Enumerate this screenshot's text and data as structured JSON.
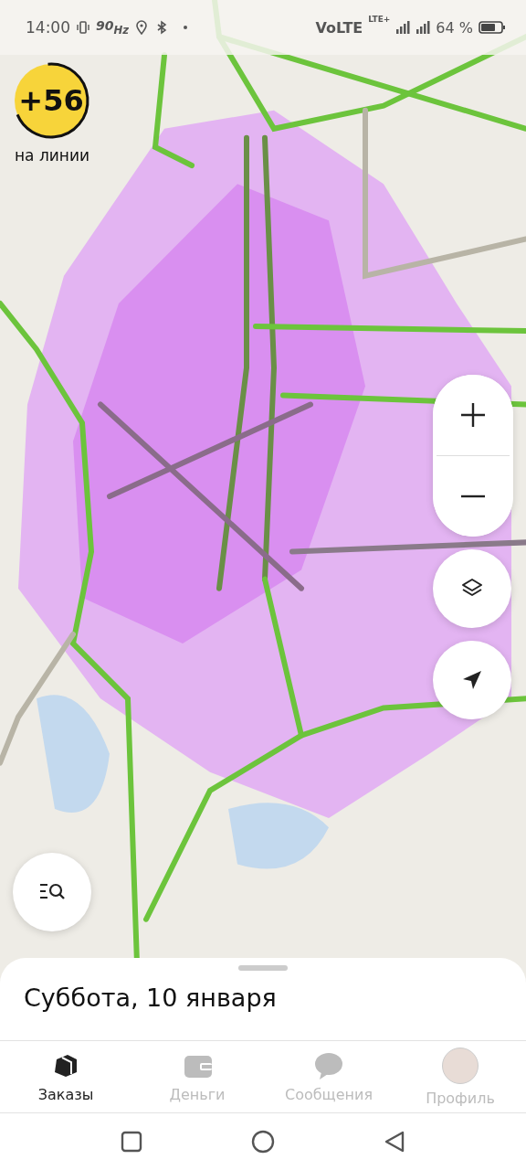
{
  "status_bar": {
    "time": "14:00",
    "refresh_rate": "90$_{Hz}$",
    "network": "VoLTE",
    "lte": "LTE+",
    "battery": "64 %"
  },
  "online_badge": {
    "count": "+56",
    "label": "на линии"
  },
  "sheet": {
    "title": "Суббота, 10 января"
  },
  "tabs": [
    {
      "label": "Заказы",
      "selected": true
    },
    {
      "label": "Деньги",
      "selected": false
    },
    {
      "label": "Сообщения",
      "selected": false
    },
    {
      "label": "Профиль",
      "selected": false
    }
  ]
}
